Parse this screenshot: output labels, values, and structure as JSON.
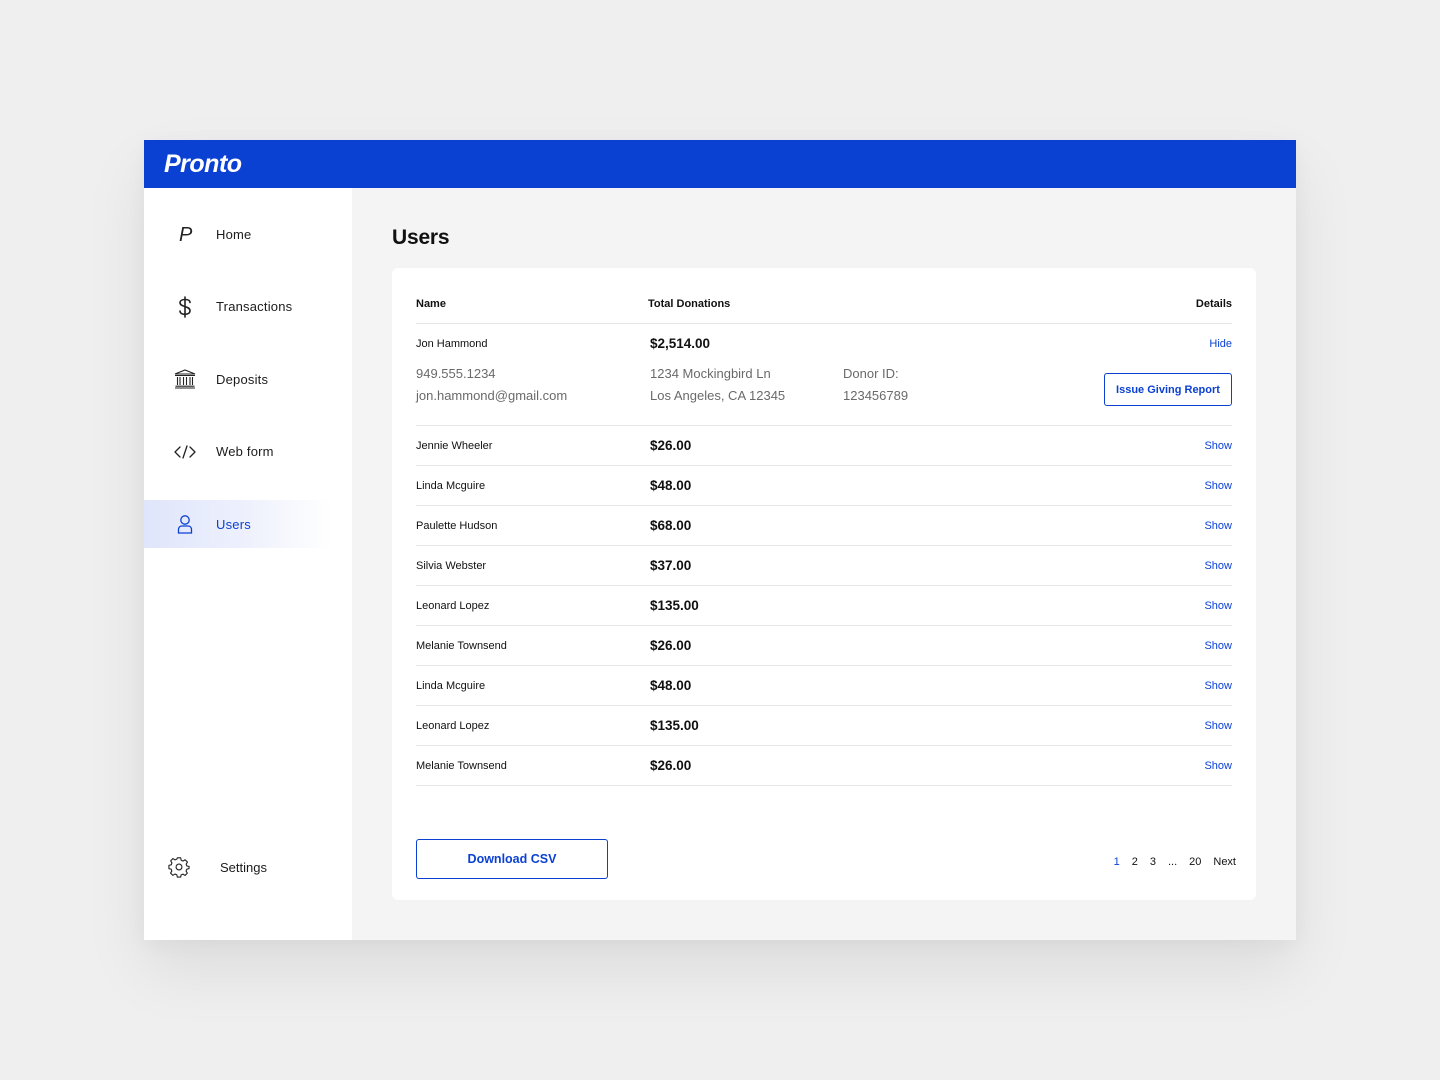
{
  "app": {
    "logo": "Pronto"
  },
  "sidebar": {
    "items": [
      {
        "label": "Home",
        "icon": "pronto-p-icon"
      },
      {
        "label": "Transactions",
        "icon": "dollar-icon"
      },
      {
        "label": "Deposits",
        "icon": "bank-icon"
      },
      {
        "label": "Web form",
        "icon": "code-icon"
      },
      {
        "label": "Users",
        "icon": "user-icon",
        "active": true
      }
    ],
    "settings": {
      "label": "Settings",
      "icon": "gear-icon"
    }
  },
  "main": {
    "title": "Users",
    "table": {
      "headers": {
        "name": "Name",
        "total": "Total Donations",
        "details": "Details"
      },
      "expanded": {
        "name": "Jon  Hammond",
        "amount": "$2,514.00",
        "toggle": "Hide",
        "phone": "949.555.1234",
        "email": "jon.hammond@gmail.com",
        "address_line1": "1234 Mockingbird Ln",
        "address_line2": "Los Angeles, CA 12345",
        "donor_label": "Donor ID:",
        "donor_id": "123456789",
        "report_button": "Issue Giving Report"
      },
      "rows": [
        {
          "name": "Jennie Wheeler",
          "amount": "$26.00",
          "toggle": "Show"
        },
        {
          "name": "Linda Mcguire",
          "amount": "$48.00",
          "toggle": "Show"
        },
        {
          "name": "Paulette Hudson",
          "amount": "$68.00",
          "toggle": "Show"
        },
        {
          "name": "Silvia Webster",
          "amount": "$37.00",
          "toggle": "Show"
        },
        {
          "name": "Leonard Lopez",
          "amount": "$135.00",
          "toggle": "Show"
        },
        {
          "name": "Melanie  Townsend",
          "amount": "$26.00",
          "toggle": "Show"
        },
        {
          "name": "Linda Mcguire",
          "amount": "$48.00",
          "toggle": "Show"
        },
        {
          "name": "Leonard Lopez",
          "amount": "$135.00",
          "toggle": "Show"
        },
        {
          "name": "Melanie  Townsend",
          "amount": "$26.00",
          "toggle": "Show"
        }
      ]
    },
    "download_button": "Download CSV",
    "pagination": {
      "pages": [
        "1",
        "2",
        "3"
      ],
      "ellipsis": "...",
      "last": "20",
      "next": "Next",
      "current": "1"
    }
  },
  "colors": {
    "brand": "#0b41d2",
    "background": "#efefef"
  }
}
